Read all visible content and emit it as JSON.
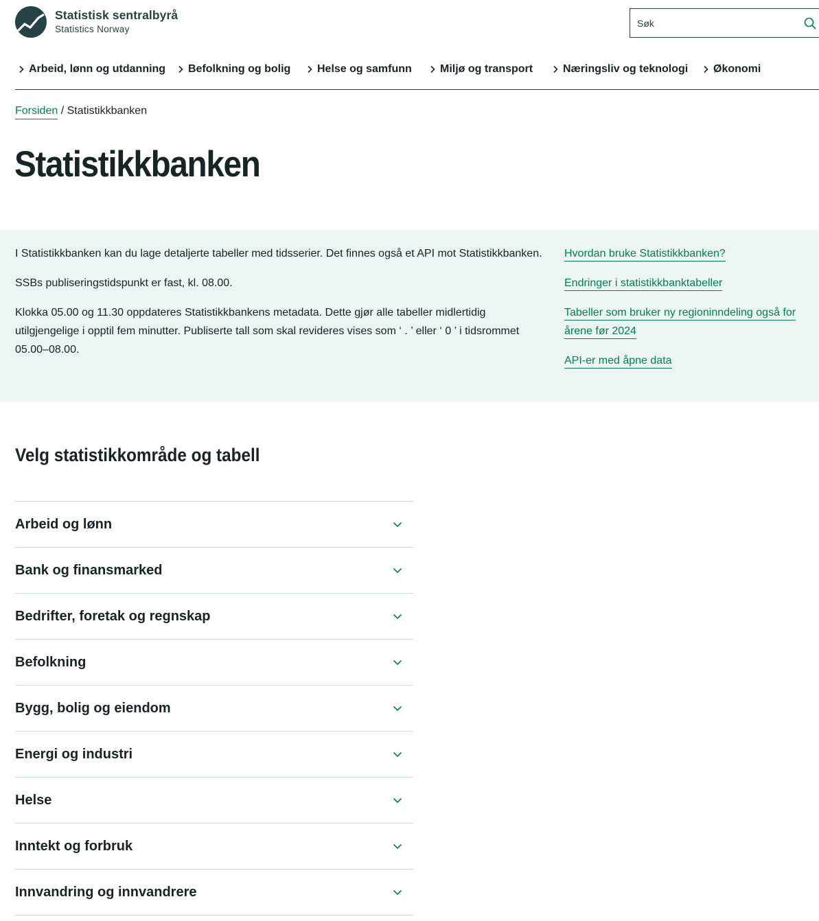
{
  "header": {
    "logo_title": "Statistisk sentralbyrå",
    "logo_subtitle": "Statistics Norway",
    "search_placeholder": "Søk",
    "search_icon": "search-icon"
  },
  "nav": {
    "items": [
      {
        "label": "Arbeid, lønn og utdanning"
      },
      {
        "label": "Befolkning og bolig"
      },
      {
        "label": "Helse og samfunn"
      },
      {
        "label": "Miljø og transport"
      },
      {
        "label": "Næringsliv og teknologi"
      },
      {
        "label": "Økonomi"
      }
    ]
  },
  "breadcrumb": {
    "home": "Forsiden",
    "separator": " / ",
    "current": "Statistikkbanken"
  },
  "page_title": "Statistikkbanken",
  "info": {
    "paragraphs": [
      "I Statistikkbanken kan du lage detaljerte tabeller med tidsserier. Det finnes også et API mot Statistikkbanken.",
      "SSBs publiseringstidspunkt er fast, kl. 08.00.",
      "Klokka 05.00 og 11.30 oppdateres Statistikkbankens metadata. Dette gjør alle tabeller midlertidig utilgjengelige i opptil fem minutter. Publiserte tall som skal revideres vises som ‘ . ’ eller ‘ 0 ’ i tidsrommet 05.00–08.00."
    ],
    "links": [
      "Hvordan bruke Statistikkbanken?",
      "Endringer i statistikkbanktabeller",
      "Tabeller som bruker ny regioninndeling også for årene før 2024",
      "API-er med åpne data"
    ]
  },
  "section_title": "Velg statistikkområde og tabell",
  "accordion": [
    "Arbeid og lønn",
    "Bank og finansmarked",
    "Bedrifter, foretak og regnskap",
    "Befolkning",
    "Bygg, bolig og eiendom",
    "Energi og industri",
    "Helse",
    "Inntekt og forbruk",
    "Innvandring og innvandrere"
  ],
  "colors": {
    "brand_dark": "#274247",
    "link_green": "#00824d",
    "info_bg": "#ecf4f4",
    "divider": "#c3dcdc",
    "text": "#162327"
  }
}
